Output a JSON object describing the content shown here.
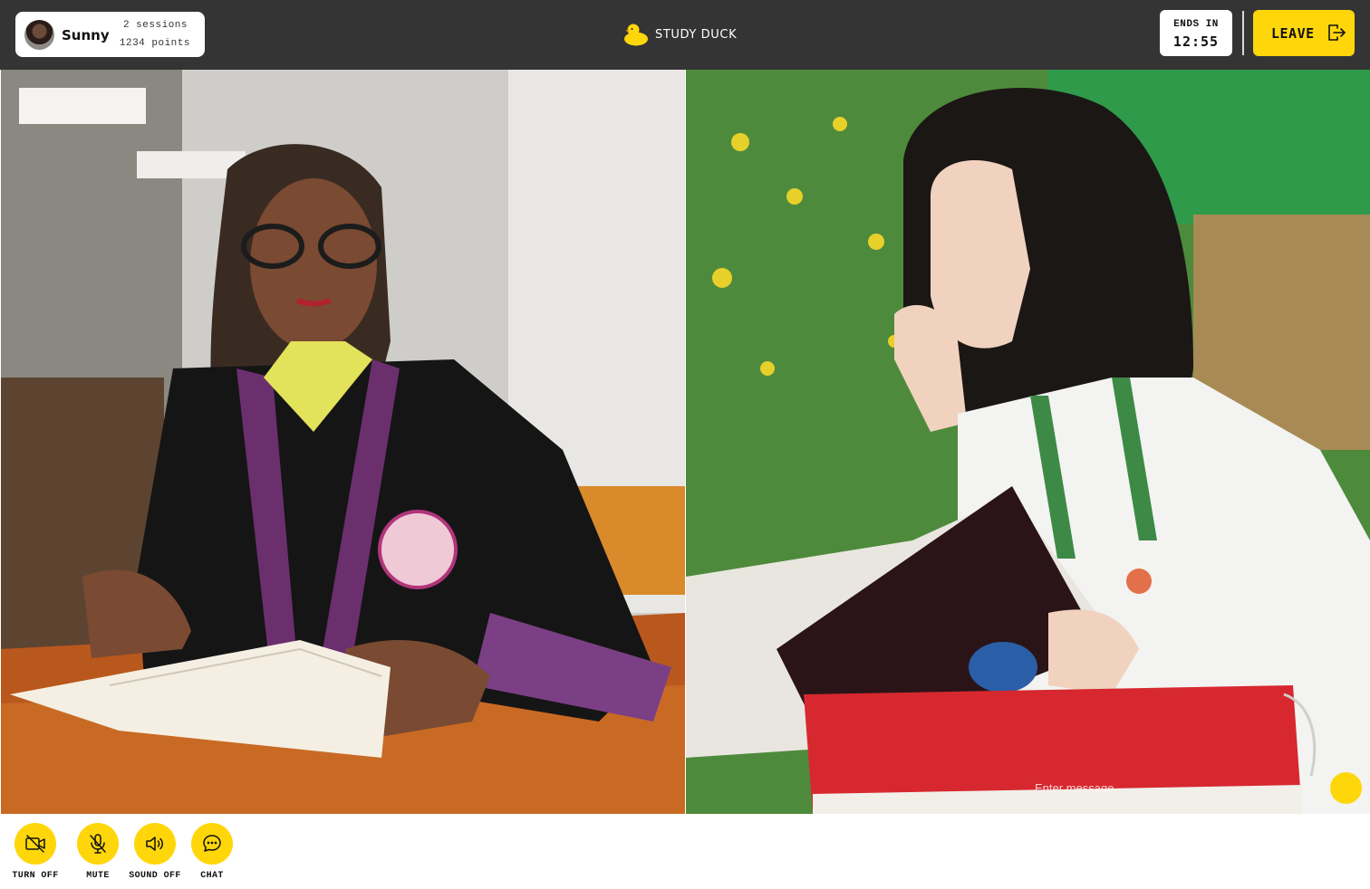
{
  "header": {
    "user": {
      "name": "Sunny",
      "sessions": "2 sessions",
      "points": "1234 points",
      "avatar_icon": "user-avatar"
    },
    "brand": {
      "name": "STUDY DUCK",
      "icon": "duck-icon",
      "color": "#ffd60a"
    },
    "timer": {
      "label": "ENDS IN",
      "value": "12:55"
    },
    "leave": {
      "label": "LEAVE",
      "icon": "logout-icon"
    }
  },
  "tiles": [
    {
      "name": "participant-left"
    },
    {
      "name": "participant-right"
    }
  ],
  "chat": {
    "placeholder": "Enter message",
    "send_icon": "send-icon"
  },
  "controls": [
    {
      "label": "TURN OFF",
      "icon": "camera-off-icon"
    },
    {
      "label": "MUTE",
      "icon": "mic-off-icon"
    },
    {
      "label": "SOUND OFF",
      "icon": "speaker-icon"
    },
    {
      "label": "CHAT",
      "icon": "chat-icon"
    }
  ],
  "colors": {
    "topbar": "#343434",
    "accent": "#ffd60a",
    "background": "#ffffff"
  }
}
